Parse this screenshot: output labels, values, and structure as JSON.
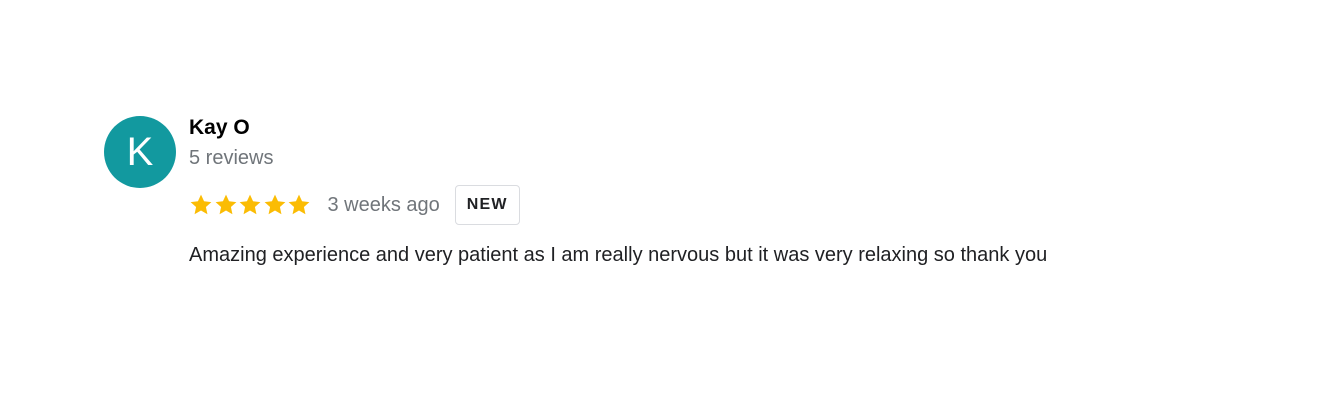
{
  "review": {
    "avatar_letter": "K",
    "avatar_color": "#12999f",
    "reviewer_name": "Kay O",
    "review_count": "5 reviews",
    "rating": 5,
    "rating_max": 5,
    "star_color": "#fbbc04",
    "icon": "star-icon",
    "date": "3 weeks ago",
    "badge": "NEW",
    "text": "Amazing experience and very patient as I am really nervous but it was very relaxing so thank you"
  }
}
